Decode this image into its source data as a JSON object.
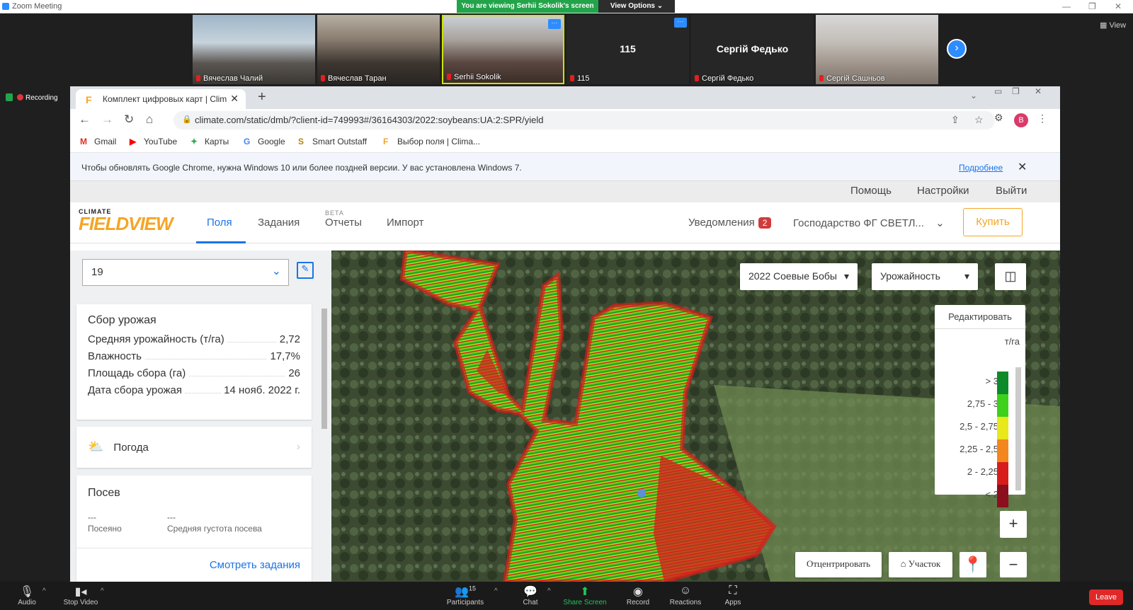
{
  "zoom": {
    "title": "Zoom Meeting",
    "viewing_banner": "You are viewing Serhii Sokolik's screen",
    "view_options": "View Options",
    "view_btn": "View",
    "recording": "Recording"
  },
  "participants": [
    {
      "name": "Вячеслав Чалий",
      "show_name": ""
    },
    {
      "name": "Вячеслав Таран",
      "show_name": ""
    },
    {
      "name": "Serhii Sokolik",
      "show_name": ""
    },
    {
      "name": "115",
      "show_name": "115"
    },
    {
      "name": "Сергій Федько",
      "show_name": "Сергій Федько"
    },
    {
      "name": "Сергій Сашньов",
      "show_name": ""
    }
  ],
  "browser": {
    "tab_title": "Комплект цифровых карт | Clim",
    "url": "climate.com/static/dmb/?client-id=749993#/36164303/2022:soybeans:UA:2:SPR/yield",
    "avatar": "B",
    "bookmarks": [
      "Gmail",
      "YouTube",
      "Карты",
      "Google",
      "Smart Outstaff",
      "Выбор поля | Clima..."
    ],
    "warning": "Чтобы обновлять Google Chrome, нужна Windows 10 или более поздней версии. У вас установлена Windows 7.",
    "warning_link": "Подробнее"
  },
  "fv": {
    "top_links": [
      "Помощь",
      "Настройки",
      "Выйти"
    ],
    "logo_top": "CLIMATE",
    "logo_main": "FIELDVIEW",
    "nav": [
      "Поля",
      "Задания",
      "Отчеты",
      "Импорт"
    ],
    "beta": "BETA",
    "notifications": "Уведомления",
    "notif_count": "2",
    "farm": "Господарство ФГ СВЕТЛ...",
    "buy": "Купить"
  },
  "sidebar": {
    "field": "19",
    "harvest": {
      "title": "Сбор урожая",
      "rows": [
        {
          "label": "Средняя урожайность (т/га)",
          "value": "2,72"
        },
        {
          "label": "Влажность",
          "value": "17,7%"
        },
        {
          "label": "Площадь сбора (га)",
          "value": "26"
        },
        {
          "label": "Дата сбора урожая",
          "value": "14 нояб. 2022 г."
        }
      ]
    },
    "weather": "Погода",
    "planting": {
      "title": "Посев",
      "planted_value": "---",
      "planted_label": "Посеяно",
      "density_value": "---",
      "density_label": "Средняя густота посева"
    },
    "link": "Смотреть задания"
  },
  "map": {
    "season": "2022 Соевые Бобы",
    "layer": "Урожайность",
    "legend_edit": "Редактировать",
    "unit": "т/га",
    "legend": [
      {
        "label": "> 3",
        "color": "#0d8a2a"
      },
      {
        "label": "2,75 - 3",
        "color": "#3dd11c"
      },
      {
        "label": "2,5 - 2,75",
        "color": "#e8e81a"
      },
      {
        "label": "2,25 - 2,5",
        "color": "#f3861d"
      },
      {
        "label": "2 - 2,25",
        "color": "#d81c1c"
      },
      {
        "label": "< 2",
        "color": "#8c0f1d"
      }
    ],
    "center_btn": "Отцентрировать",
    "plot_btn": "Участок"
  },
  "toolbar": {
    "audio": "Audio",
    "stop_video": "Stop Video",
    "participants": "Participants",
    "participants_count": "15",
    "chat": "Chat",
    "share": "Share Screen",
    "record": "Record",
    "reactions": "Reactions",
    "apps": "Apps",
    "leave": "Leave"
  }
}
